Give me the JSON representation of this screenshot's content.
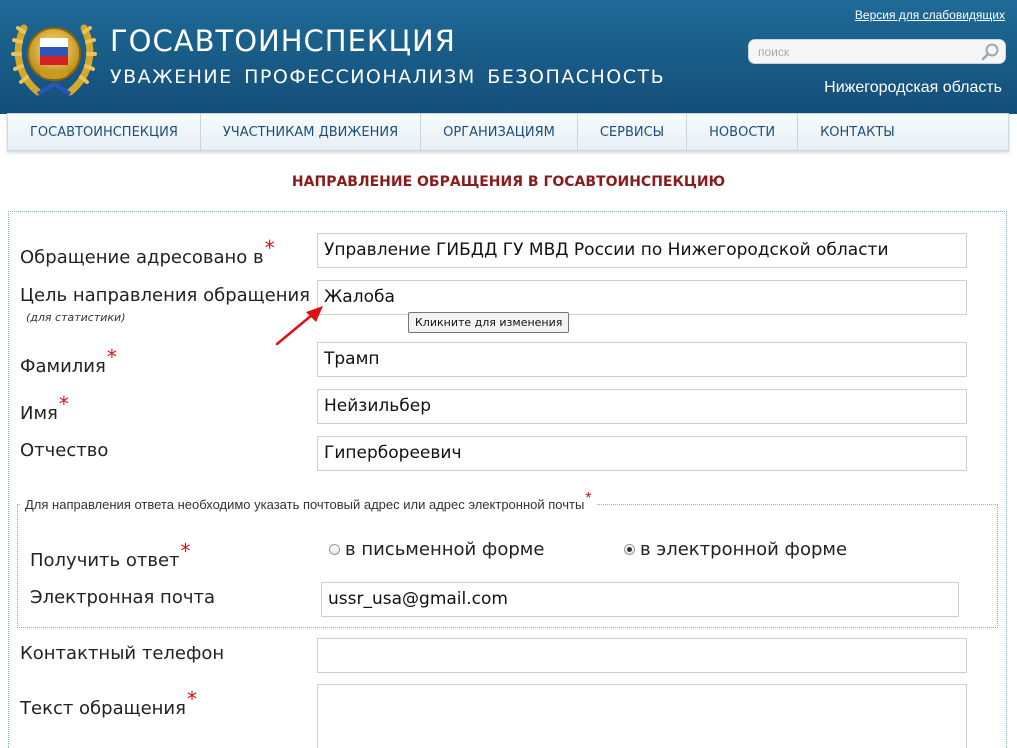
{
  "header": {
    "title": "ГОСАВТОИНСПЕКЦИЯ",
    "slogan": "УВАЖЕНИЕ  ПРОФЕССИОНАЛИЗМ  БЕЗОПАСНОСТЬ",
    "accessibility_link": "Версия для слабовидящих",
    "search_placeholder": "поиск",
    "region": "Нижегородская область"
  },
  "nav": {
    "items": [
      "ГОСАВТОИНСПЕКЦИЯ",
      "УЧАСТНИКАМ ДВИЖЕНИЯ",
      "ОРГАНИЗАЦИЯМ",
      "СЕРВИСЫ",
      "НОВОСТИ",
      "КОНТАКТЫ"
    ]
  },
  "page": {
    "title": "НАПРАВЛЕНИЕ ОБРАЩЕНИЯ В ГОСАВТОИНСПЕКЦИЮ"
  },
  "form": {
    "addressee_label": "Обращение адресовано в",
    "addressee_value": "Управление ГИБДД ГУ МВД России по Нижегородской области",
    "purpose_label": "Цель направления обращения",
    "purpose_sublabel": "(для статистики)",
    "purpose_value": "Жалоба",
    "purpose_tooltip": "Кликните для изменения",
    "surname_label": "Фамилия",
    "surname_value": "Трамп",
    "name_label": "Имя",
    "name_value": "Нейзильбер",
    "patronymic_label": "Отчество",
    "patronymic_value": "Гипербореевич",
    "reply_legend": "Для направления ответа необходимо указать почтовый адрес или адрес электронной почты",
    "get_reply_label": "Получить ответ",
    "reply_options": [
      {
        "label": "в письменной форме",
        "checked": false
      },
      {
        "label": "в электронной форме",
        "checked": true
      }
    ],
    "email_label": "Электронная почта",
    "email_value": "ussr_usa@gmail.com",
    "phone_label": "Контактный телефон",
    "phone_value": "",
    "text_label": "Текст обращения",
    "text_value": "",
    "required_mark": "*"
  },
  "colors": {
    "header_bg": "#185a86",
    "nav_text": "#1d4f7a",
    "title_red": "#8b1b1b",
    "required_star": "#e01010"
  }
}
